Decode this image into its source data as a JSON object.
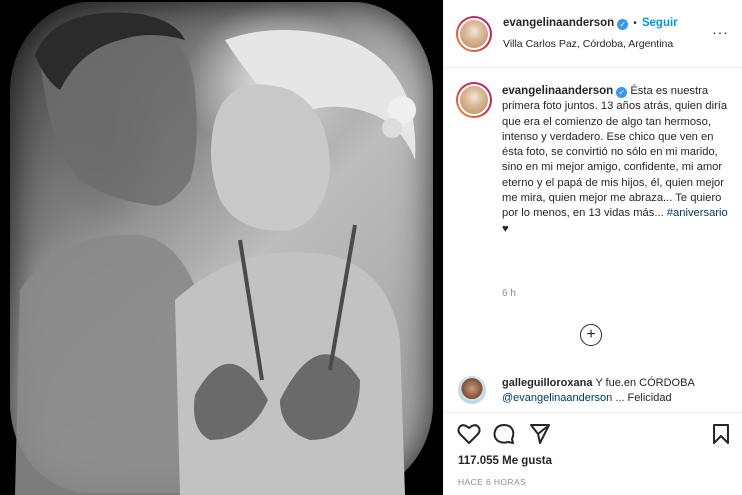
{
  "post": {
    "username": "evangelinaanderson",
    "verified_mark": "✓",
    "follow_label": "Seguir",
    "dot": "•",
    "location": "Villa Carlos Paz, Córdoba, Argentina",
    "more_label": "···",
    "caption_body": "Ésta es nuestra primera foto juntos. 13 años atrás, quien diría que era el comienzo de algo tan hermoso, intenso y verdadero. Ese chico que ven en ésta foto, se convirtió no sólo en mi marido, sino en mi mejor amigo, confidente, mi amor eterno y el papá de mis hijos, él, quien mejor me mira, quien mejor me abraza... Te quiero por lo menos, en 13 vidas más...",
    "hashtag": "#aniversario",
    "heart_emoji": "♥",
    "time": "6 h",
    "load_more": "+",
    "comment": {
      "username": "galleguilloroxana",
      "text": "Y fue.en CÓRDOBA",
      "mention": "@evangelinaanderson",
      "text2": "... Felicidad"
    },
    "likes": "117.055 Me gusta",
    "ago": "HACE 6 HORAS"
  },
  "icons": [
    "heart-icon",
    "comment-icon",
    "share-icon",
    "bookmark-icon",
    "verified-badge-icon",
    "more-options-icon",
    "plus-circle-icon"
  ]
}
